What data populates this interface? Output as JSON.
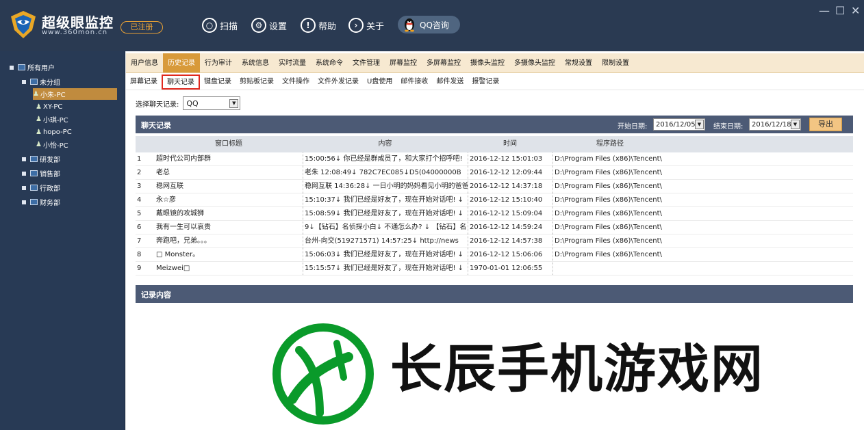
{
  "brand": {
    "title": "超级眼监控",
    "url": "www.360mon.cn",
    "badge": "已注册"
  },
  "topnav": [
    {
      "label": "扫描",
      "icon": "search-icon"
    },
    {
      "label": "设置",
      "icon": "gear-icon"
    },
    {
      "label": "帮助",
      "icon": "help-icon"
    },
    {
      "label": "关于",
      "icon": "about-icon"
    }
  ],
  "qq_button": "QQ咨询",
  "window_controls": {
    "minimize": "—",
    "maximize": "☐",
    "close": "✕"
  },
  "sidebar": {
    "root": "所有用户",
    "groups": [
      {
        "label": "未分组"
      },
      {
        "label": "研发部"
      },
      {
        "label": "销售部"
      },
      {
        "label": "行政部"
      },
      {
        "label": "财务部"
      }
    ],
    "users": [
      "小朱-PC",
      "XY-PC",
      "小琪-PC",
      "hopo-PC",
      "小怡-PC"
    ]
  },
  "tabs_main": [
    "用户信息",
    "历史记录",
    "行为审计",
    "系统信息",
    "实时流量",
    "系统命令",
    "文件管理",
    "屏幕监控",
    "多屏幕监控",
    "摄像头监控",
    "多摄像头监控",
    "常规设置",
    "限制设置"
  ],
  "tabs_sub": [
    "屏幕记录",
    "聊天记录",
    "键盘记录",
    "剪贴板记录",
    "文件操作",
    "文件外发记录",
    "U盘使用",
    "邮件接收",
    "邮件发送",
    "报警记录"
  ],
  "filter": {
    "label": "选择聊天记录:",
    "value": "QQ"
  },
  "chat_panel": {
    "title": "聊天记录",
    "start_label": "开始日期:",
    "start_date": "2016/12/05",
    "end_label": "结束日期:",
    "end_date": "2016/12/18",
    "export": "导出"
  },
  "table": {
    "headers": [
      "窗口标题",
      "内容",
      "时间",
      "程序路径"
    ],
    "rows": [
      [
        "1",
        "超时代公司内部群",
        "15:00:56↓ 你已经是群成员了，和大家打个招呼吧!",
        "2016-12-12 15:01:03",
        "D:\\Program Files (x86)\\Tencent\\"
      ],
      [
        "2",
        "老总",
        "老朱 12:08:49↓ 782C7EC085↓D5(04000000B",
        "2016-12-12 12:09:44",
        "D:\\Program Files (x86)\\Tencent\\"
      ],
      [
        "3",
        "稳网互联",
        "稳网互联 14:36:28↓ 一日小明的妈妈看见小明的爸爸",
        "2016-12-12 14:37:18",
        "D:\\Program Files (x86)\\Tencent\\"
      ],
      [
        "4",
        "永☆彦",
        "15:10:37↓ 我们已经是好友了，现在开始对话吧! ↓",
        "2016-12-12 15:10:40",
        "D:\\Program Files (x86)\\Tencent\\"
      ],
      [
        "5",
        "戴眼镜的攻城狮",
        "15:08:59↓ 我们已经是好友了，现在开始对话吧! ↓",
        "2016-12-12 15:09:04",
        "D:\\Program Files (x86)\\Tencent\\"
      ],
      [
        "6",
        "我有一生可以哀贵",
        "9↓【钻石】名侦探小白↓ 不通怎么办? ↓ 【钻石】名",
        "2016-12-12 14:59:24",
        "D:\\Program Files (x86)\\Tencent\\"
      ],
      [
        "7",
        "奔跑吧，兄弟。。。",
        "台州-向交(519271571) 14:57:25↓ http://news",
        "2016-12-12 14:57:38",
        "D:\\Program Files (x86)\\Tencent\\"
      ],
      [
        "8",
        "□ Monster。",
        "15:06:03↓ 我们已经是好友了，现在开始对话吧! ↓",
        "2016-12-12 15:06:06",
        "D:\\Program Files (x86)\\Tencent\\"
      ],
      [
        "9",
        "Meizwei□",
        "15:15:57↓ 我们已经是好友了，现在开始对话吧! ↓",
        "1970-01-01 12:06:55",
        ""
      ]
    ]
  },
  "content_panel": {
    "title": "记录内容"
  },
  "watermark": {
    "text": "长辰手机游戏网"
  },
  "colors": {
    "accent": "#d89a3a",
    "topbar": "#2a3a52",
    "sidebar": "#283a55",
    "panel_head": "#4c5a75",
    "watermark_green": "#0a9a2a"
  }
}
